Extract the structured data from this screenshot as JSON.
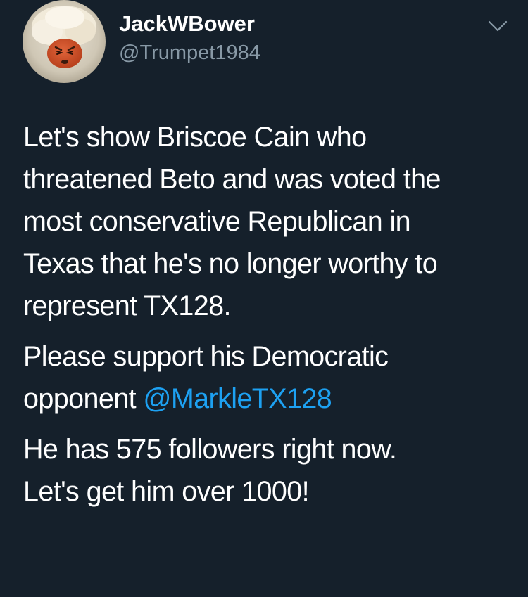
{
  "tweet": {
    "display_name": "JackWBower",
    "handle": "@Trumpet1984",
    "paragraphs": [
      {
        "lines": [
          "Let's show Briscoe Cain who",
          "threatened Beto and was voted the",
          "most conservative Republican in",
          "Texas that he's no longer worthy to",
          "represent TX128."
        ]
      },
      {
        "lines": [
          "Please support his Democratic"
        ],
        "last_line_prefix": "opponent ",
        "mention": "@MarkleTX128"
      },
      {
        "lines": [
          "He has 575 followers right now.",
          "Let's get him over 1000!"
        ]
      }
    ],
    "icons": {
      "menu": "chevron-down-icon",
      "avatar": "profile-avatar"
    },
    "colors": {
      "background": "#15202b",
      "text": "#ffffff",
      "secondary_text": "#8899a6",
      "link": "#1da1f2"
    }
  }
}
